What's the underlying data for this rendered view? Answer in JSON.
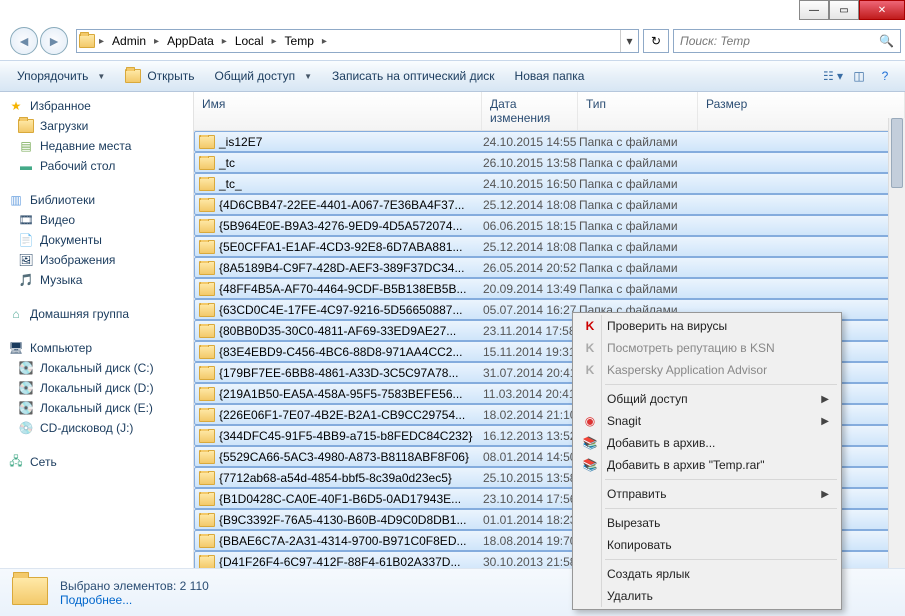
{
  "window": {
    "min": "—",
    "max": "▭",
    "close": "✕"
  },
  "breadcrumbs": [
    "Admin",
    "AppData",
    "Local",
    "Temp"
  ],
  "search": {
    "placeholder": "Поиск: Temp"
  },
  "toolbar": {
    "organize": "Упорядочить",
    "open": "Открыть",
    "share": "Общий доступ",
    "burn": "Записать на оптический диск",
    "newfolder": "Новая папка"
  },
  "sidebar": {
    "favorites": {
      "label": "Избранное",
      "items": [
        "Загрузки",
        "Недавние места",
        "Рабочий стол"
      ]
    },
    "libraries": {
      "label": "Библиотеки",
      "items": [
        "Видео",
        "Документы",
        "Изображения",
        "Музыка"
      ]
    },
    "homegroup": {
      "label": "Домашняя группа"
    },
    "computer": {
      "label": "Компьютер",
      "items": [
        "Локальный диск (C:)",
        "Локальный диск (D:)",
        "Локальный диск (E:)",
        "CD-дисковод (J:)"
      ]
    },
    "network": {
      "label": "Сеть"
    }
  },
  "columns": {
    "name": "Имя",
    "date": "Дата изменения",
    "type": "Тип",
    "size": "Размер"
  },
  "filetype": "Папка с файлами",
  "files": [
    {
      "name": "_is12E7",
      "date": "24.10.2015 14:55",
      "sel": true,
      "typed": true
    },
    {
      "name": "_tc",
      "date": "26.10.2015 13:58",
      "sel": true,
      "typed": true
    },
    {
      "name": "_tc_",
      "date": "24.10.2015 16:50",
      "sel": true,
      "typed": true
    },
    {
      "name": "{4D6CBB47-22EE-4401-A067-7E36BA4F37...",
      "date": "25.12.2014 18:08",
      "sel": true,
      "typed": true
    },
    {
      "name": "{5B964E0E-B9A3-4276-9ED9-4D5A572074...",
      "date": "06.06.2015 18:15",
      "sel": true,
      "typed": true
    },
    {
      "name": "{5E0CFFA1-E1AF-4CD3-92E8-6D7ABA881...",
      "date": "25.12.2014 18:08",
      "sel": true,
      "typed": true
    },
    {
      "name": "{8A5189B4-C9F7-428D-AEF3-389F37DC34...",
      "date": "26.05.2014 20:52",
      "sel": true,
      "typed": true
    },
    {
      "name": "{48FF4B5A-AF70-4464-9CDF-B5B138EB5B...",
      "date": "20.09.2014 13:49",
      "sel": true,
      "typed": true
    },
    {
      "name": "{63CD0C4E-17FE-4C97-9216-5D56650887...",
      "date": "05.07.2014 16:27",
      "sel": true,
      "typed": true
    },
    {
      "name": "{80BB0D35-30C0-4811-AF69-33ED9AE27...",
      "date": "23.11.2014 17:58",
      "sel": true
    },
    {
      "name": "{83E4EBD9-C456-4BC6-88D8-971AA4CC2...",
      "date": "15.11.2014 19:31",
      "sel": true
    },
    {
      "name": "{179BF7EE-6BB8-4861-A33D-3C5C97A78...",
      "date": "31.07.2014 20:41",
      "sel": true
    },
    {
      "name": "{219A1B50-EA5A-458A-95F5-7583BEFE56...",
      "date": "11.03.2014 20:41",
      "sel": true
    },
    {
      "name": "{226E06F1-7E07-4B2E-B2A1-CB9CC29754...",
      "date": "18.02.2014 21:10",
      "sel": true
    },
    {
      "name": "{344DFC45-91F5-4BB9-a715-b8FEDC84C232}",
      "date": "16.12.2013 13:52",
      "sel": true
    },
    {
      "name": "{5529CA66-5AC3-4980-A873-B8118ABF8F06}",
      "date": "08.01.2014 14:50",
      "sel": true
    },
    {
      "name": "{7712ab68-a54d-4854-bbf5-8c39a0d23ec5}",
      "date": "25.10.2015 13:58",
      "sel": true
    },
    {
      "name": "{B1D0428C-CA0E-40F1-B6D5-0AD17943E...",
      "date": "23.10.2014 17:56",
      "sel": true
    },
    {
      "name": "{B9C3392F-76A5-4130-B60B-4D9C0D8DB1...",
      "date": "01.01.2014 18:23",
      "sel": true
    },
    {
      "name": "{BBAE6C7A-2A31-4314-9700-B971C0F8ED...",
      "date": "18.08.2014 19:70",
      "sel": true
    },
    {
      "name": "{D41F26F4-6C97-412F-88F4-61B02A337D...",
      "date": "30.10.2013 21:58",
      "sel": true
    }
  ],
  "details": {
    "line1": "Выбрано элементов: 2 110",
    "line2": "Подробнее..."
  },
  "context": {
    "scan": "Проверить на вирусы",
    "ksn": "Посмотреть репутацию в KSN",
    "kaa": "Kaspersky Application Advisor",
    "share": "Общий доступ",
    "snagit": "Snagit",
    "addarchive": "Добавить в архив...",
    "addtemp": "Добавить в архив \"Temp.rar\"",
    "send": "Отправить",
    "cut": "Вырезать",
    "copy": "Копировать",
    "shortcut": "Создать ярлык",
    "delete": "Удалить"
  }
}
